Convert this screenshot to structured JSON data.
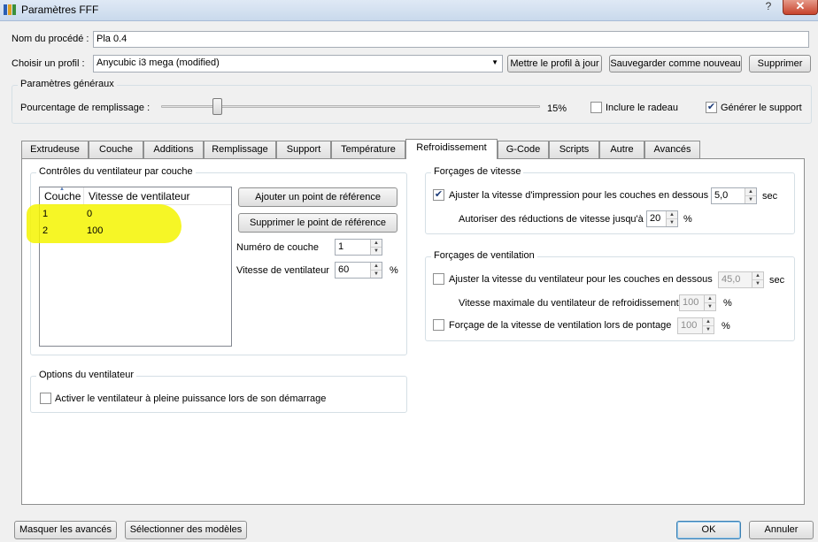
{
  "window": {
    "title": "Paramètres FFF",
    "help_label": "?",
    "close_label": "✕"
  },
  "process": {
    "name_label": "Nom du procédé :",
    "name_value": "Pla 0.4"
  },
  "profile": {
    "label": "Choisir un profil :",
    "selected": "Anycubic i3 mega (modified)",
    "update_label": "Mettre le profil à jour",
    "save_label": "Sauvegarder comme nouveau",
    "delete_label": "Supprimer"
  },
  "general": {
    "title": "Paramètres généraux",
    "infill_label": "Pourcentage de remplissage :",
    "infill_value": "15%",
    "infill_fraction": 0.15,
    "raft_label": "Inclure le radeau",
    "raft_checked": false,
    "support_label": "Générer le support",
    "support_checked": true
  },
  "tabs": [
    {
      "label": "Extrudeuse"
    },
    {
      "label": "Couche"
    },
    {
      "label": "Additions"
    },
    {
      "label": "Remplissage"
    },
    {
      "label": "Support"
    },
    {
      "label": "Température"
    },
    {
      "label": "Refroidissement",
      "active": true
    },
    {
      "label": "G-Code"
    },
    {
      "label": "Scripts"
    },
    {
      "label": "Autre"
    },
    {
      "label": "Avancés"
    }
  ],
  "fan_controls": {
    "title": "Contrôles du ventilateur par couche",
    "columns": [
      "Couche",
      "Vitesse de ventilateur"
    ],
    "rows": [
      {
        "layer": "1",
        "speed": "0"
      },
      {
        "layer": "2",
        "speed": "100"
      }
    ],
    "add_label": "Ajouter un point de référence",
    "remove_label": "Supprimer le point de référence",
    "layer_number_label": "Numéro de couche",
    "layer_number_value": "1",
    "fan_speed_label": "Vitesse de ventilateur",
    "fan_speed_value": "60",
    "fan_speed_unit": "%"
  },
  "fan_options": {
    "title": "Options du ventilateur",
    "full_power_label": "Activer le ventilateur à pleine puissance lors de son démarrage",
    "full_power_checked": false
  },
  "speed_overrides": {
    "title": "Forçages de vitesse",
    "adjust_label": "Ajuster la vitesse d'impression pour les couches en dessous",
    "adjust_checked": true,
    "adjust_value": "5,0",
    "adjust_unit": "sec",
    "allow_label": "Autoriser des réductions de vitesse jusqu'à",
    "allow_value": "20",
    "allow_unit": "%"
  },
  "fan_overrides": {
    "title": "Forçages de ventilation",
    "adjust_label": "Ajuster la vitesse du ventilateur pour les couches en dessous",
    "adjust_checked": false,
    "adjust_value": "45,0",
    "adjust_unit": "sec",
    "max_label": "Vitesse maximale du ventilateur de refroidissement",
    "max_value": "100",
    "max_unit": "%",
    "bridge_label": "Forçage de la vitesse de ventilation lors de pontage",
    "bridge_checked": false,
    "bridge_value": "100",
    "bridge_unit": "%"
  },
  "footer": {
    "hide_advanced_label": "Masquer les avancés",
    "select_models_label": "Sélectionner des modèles",
    "ok_label": "OK",
    "cancel_label": "Annuler"
  },
  "colors": {
    "highlight": "#f5f500",
    "title_bar": "#c9d9ec",
    "close": "#c7432c"
  }
}
